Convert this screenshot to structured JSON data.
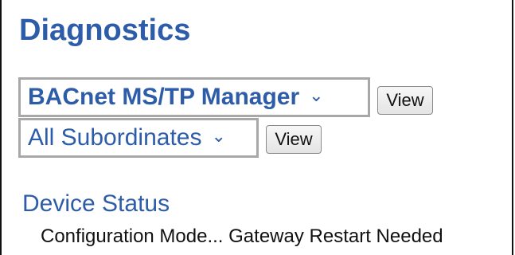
{
  "page": {
    "title": "Diagnostics"
  },
  "manager_select": {
    "selected": "BACnet MS/TP Manager",
    "chevron_icon": "chevron-down-icon",
    "view_label": "View"
  },
  "subordinate_select": {
    "selected": "All Subordinates",
    "chevron_icon": "chevron-down-icon",
    "view_label": "View"
  },
  "device_status": {
    "heading": "Device Status",
    "message": "Configuration Mode... Gateway Restart Needed"
  },
  "colors": {
    "accent": "#2d5da8",
    "select_border": "#a8a8a8",
    "text": "#111111"
  }
}
